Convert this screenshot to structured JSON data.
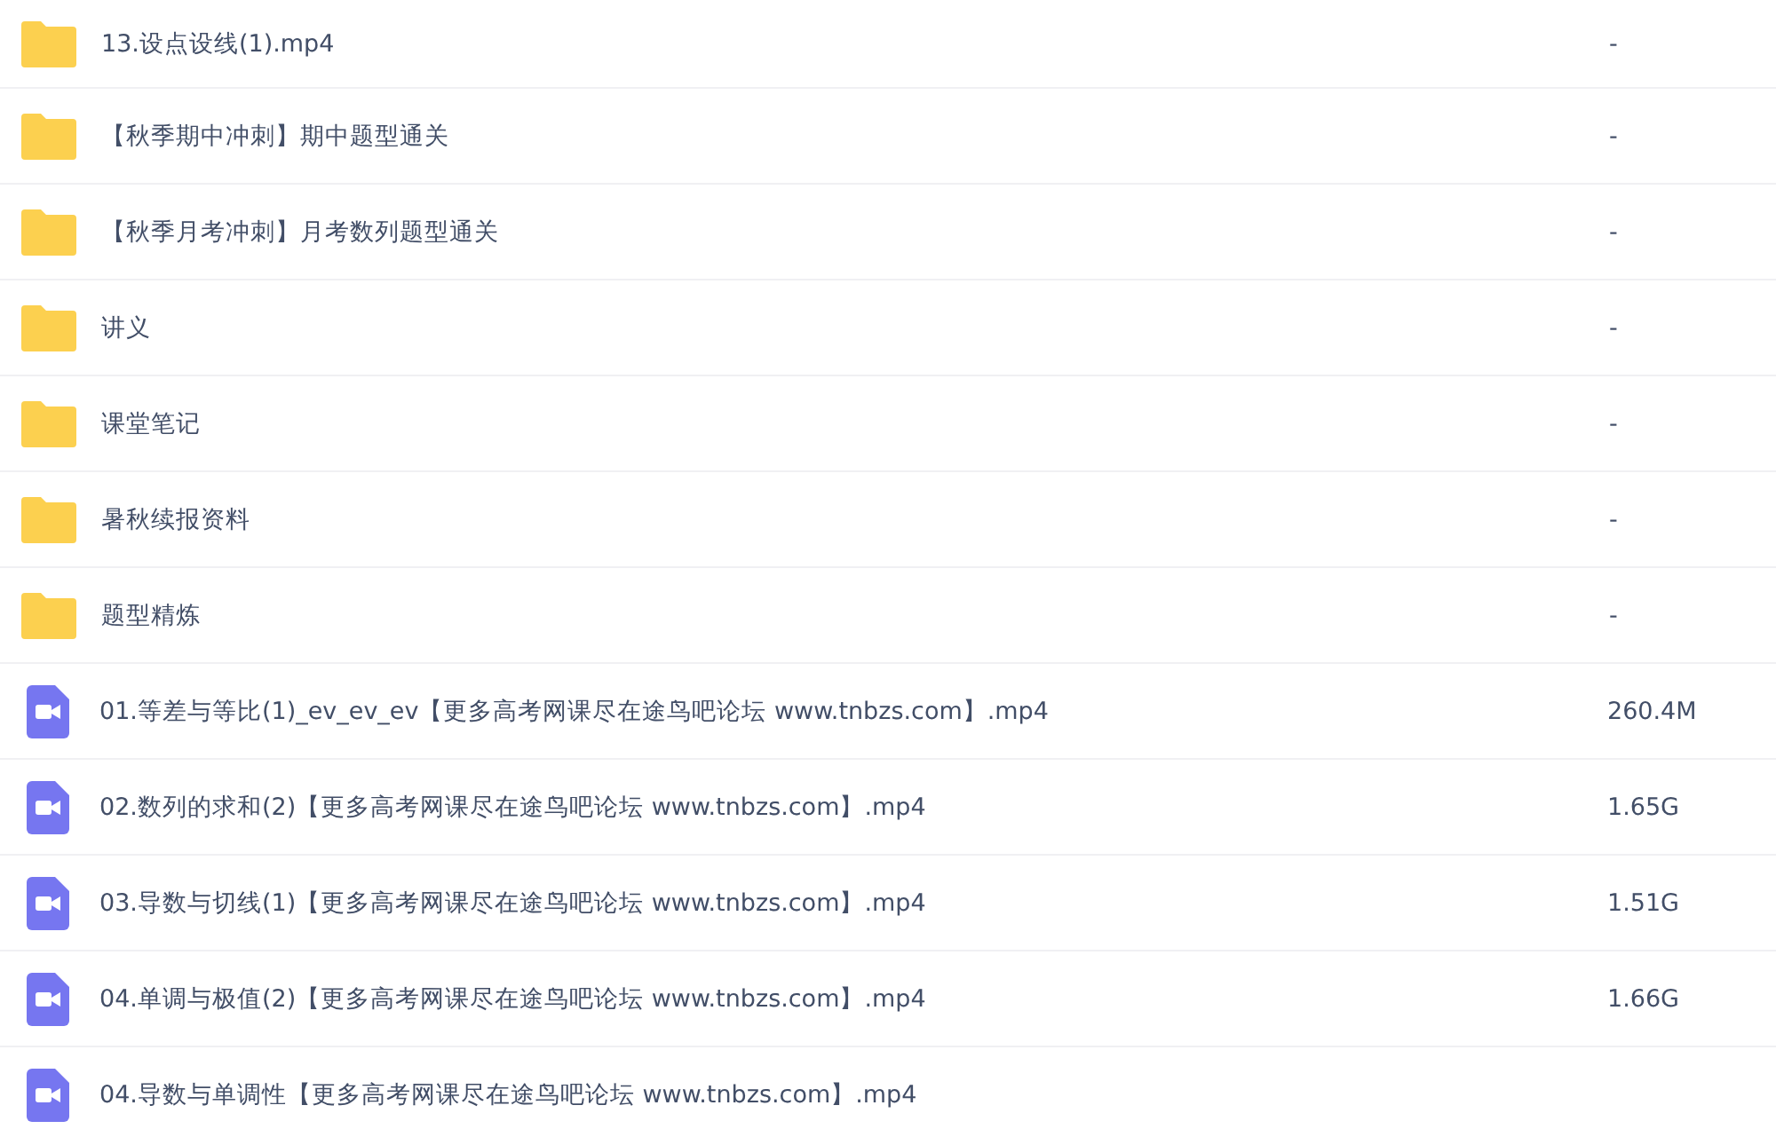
{
  "files": [
    {
      "kind": "folder",
      "name": "13.设点设线(1).mp4",
      "size": "-"
    },
    {
      "kind": "folder",
      "name": "【秋季期中冲刺】期中题型通关",
      "size": "-"
    },
    {
      "kind": "folder",
      "name": "【秋季月考冲刺】月考数列题型通关",
      "size": "-"
    },
    {
      "kind": "folder",
      "name": "讲义",
      "size": "-"
    },
    {
      "kind": "folder",
      "name": "课堂笔记",
      "size": "-"
    },
    {
      "kind": "folder",
      "name": "暑秋续报资料",
      "size": "-"
    },
    {
      "kind": "folder",
      "name": "题型精炼",
      "size": "-"
    },
    {
      "kind": "video",
      "name": "01.等差与等比(1)_ev_ev_ev【更多高考网课尽在途鸟吧论坛 www.tnbzs.com】.mp4",
      "size": "260.4M"
    },
    {
      "kind": "video",
      "name": "02.数列的求和(2)【更多高考网课尽在途鸟吧论坛 www.tnbzs.com】.mp4",
      "size": "1.65G"
    },
    {
      "kind": "video",
      "name": "03.导数与切线(1)【更多高考网课尽在途鸟吧论坛 www.tnbzs.com】.mp4",
      "size": "1.51G"
    },
    {
      "kind": "video",
      "name": "04.单调与极值(2)【更多高考网课尽在途鸟吧论坛 www.tnbzs.com】.mp4",
      "size": "1.66G"
    },
    {
      "kind": "video",
      "name": "04.导数与单调性【更多高考网课尽在途鸟吧论坛 www.tnbzs.com】.mp4"
    }
  ]
}
